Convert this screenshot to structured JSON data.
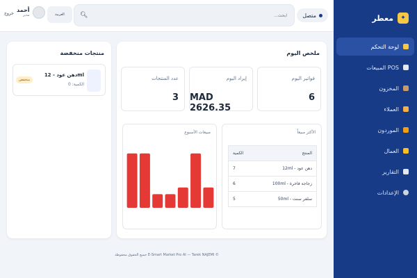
{
  "brand": {
    "name": "معطر"
  },
  "sidebar": {
    "items": [
      {
        "label": "لوحة التحكم",
        "icon": "dashboard-icon",
        "active": true
      },
      {
        "label": "المبيعات POS",
        "icon": "cart-icon",
        "count": "0"
      },
      {
        "label": "المخزون",
        "icon": "box-icon"
      },
      {
        "label": "العملاء",
        "icon": "users-icon"
      },
      {
        "label": "الموردون",
        "icon": "truck-icon"
      },
      {
        "label": "العمال",
        "icon": "worker-icon"
      },
      {
        "label": "التقارير",
        "icon": "chart-icon"
      },
      {
        "label": "الإعدادات",
        "icon": "gear-icon"
      }
    ]
  },
  "topbar": {
    "status": "متصل",
    "search_placeholder": "ابحث...",
    "lang": "العربية",
    "currency_flag": "MA",
    "user_name": "أحمد",
    "user_role": "مدير",
    "logout": "خروج"
  },
  "summary": {
    "title": "ملخص اليوم",
    "stats": [
      {
        "label": "فواتير اليوم",
        "value": "6"
      },
      {
        "label": "إيراد اليوم",
        "value": "MAD 2626.35"
      },
      {
        "label": "عدد المنتجات",
        "value": "3"
      }
    ],
    "weekly_title": "مبيعات الأسبوع",
    "top_title": "الأكثر مبيعاً",
    "top_columns": {
      "product": "المنتج",
      "qty": "الكمية"
    },
    "top_rows": [
      {
        "product": "دهن عود - 12ml",
        "qty": "7"
      },
      {
        "product": "زجاجة فاخرة - 100ml",
        "qty": "6"
      },
      {
        "product": "سلفر سنت - 50ml",
        "qty": "5"
      }
    ]
  },
  "lowstock": {
    "title": "منتجات منخفضة",
    "items": [
      {
        "name": "دهن عود - 12ml",
        "qty": "الكمية: 0",
        "badge": "منخفض"
      }
    ]
  },
  "footer": {
    "text": "جميع الحقوق محفوظة E-Smart Market Pro AI — Tarek NAJEMI ©"
  },
  "chart_data": {
    "type": "bar",
    "values": [
      8,
      8,
      2,
      2,
      3,
      8,
      3
    ],
    "ylim": [
      0,
      9
    ],
    "color": "#e53935"
  },
  "colors": {
    "sidebar": "#173b86",
    "accent": "#e53935",
    "active": "#2b51a5"
  }
}
